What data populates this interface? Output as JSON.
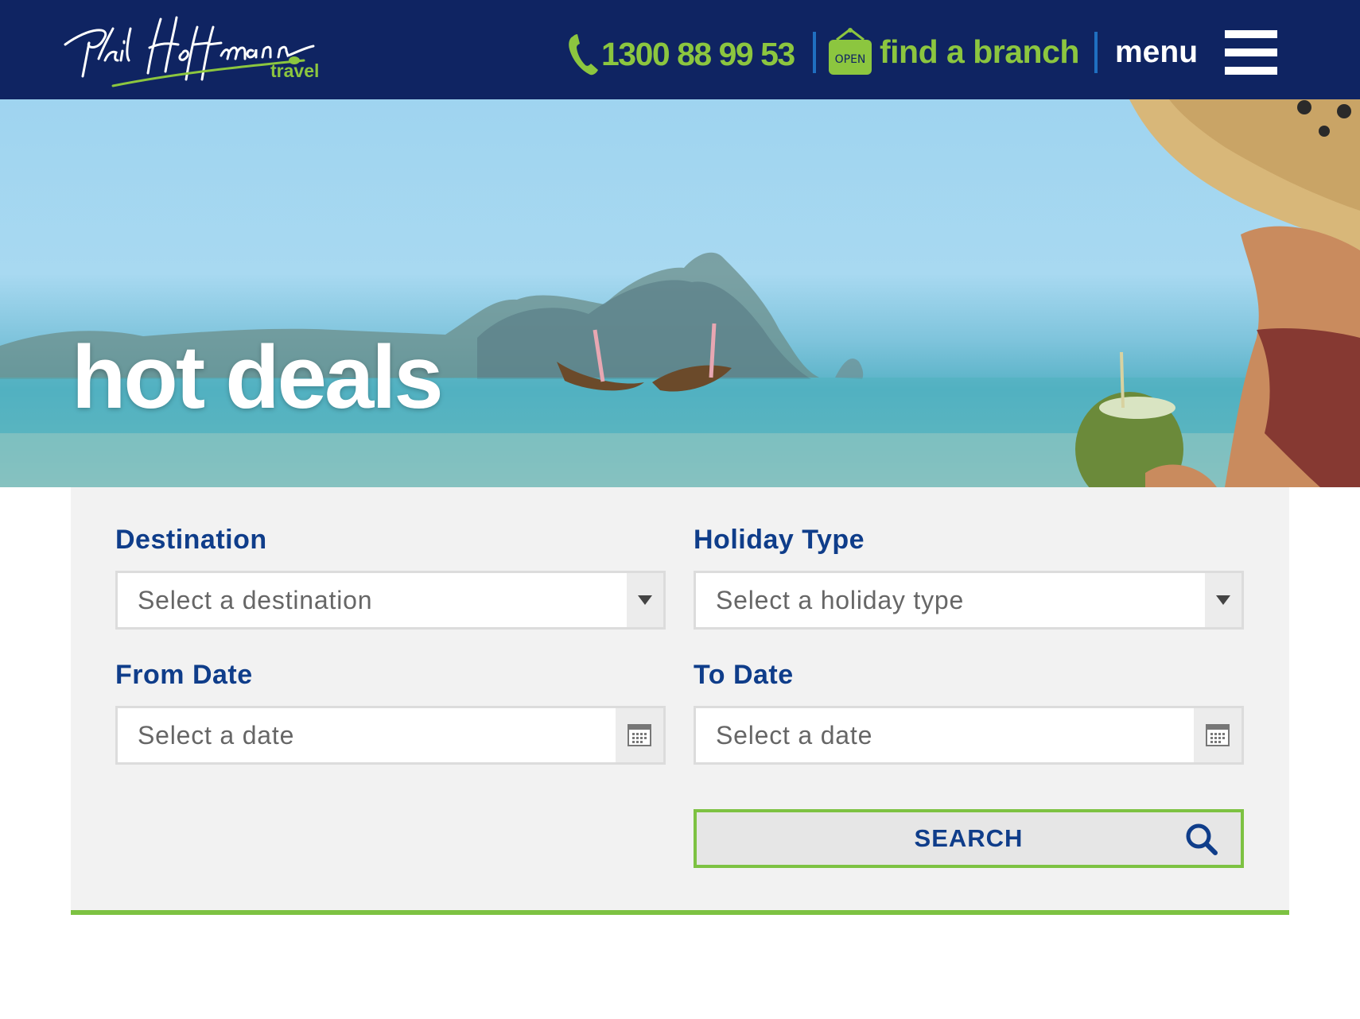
{
  "header": {
    "logo": {
      "script_text": "Phil Hoffmann",
      "sub_text": "travel"
    },
    "phone": {
      "icon": "phone-icon",
      "number": "1300 88 99 53"
    },
    "branch": {
      "icon": "open-sign-icon",
      "sign_text": "OPEN",
      "label": "find a branch"
    },
    "menu": {
      "label": "menu",
      "icon": "hamburger-icon"
    }
  },
  "colors": {
    "header_bg": "#0f2462",
    "accent_green": "#8cc63f",
    "label_blue": "#0f3d8a",
    "panel_bg": "#f2f2f2"
  },
  "hero": {
    "title": "hot deals"
  },
  "search_form": {
    "destination": {
      "label": "Destination",
      "placeholder": "Select a destination",
      "icon": "chevron-down-icon"
    },
    "holiday_type": {
      "label": "Holiday Type",
      "placeholder": "Select a holiday type",
      "icon": "chevron-down-icon"
    },
    "from_date": {
      "label": "From Date",
      "placeholder": "Select a date",
      "icon": "calendar-icon"
    },
    "to_date": {
      "label": "To Date",
      "placeholder": "Select a date",
      "icon": "calendar-icon"
    },
    "search_button": {
      "label": "SEARCH",
      "icon": "search-icon"
    }
  }
}
